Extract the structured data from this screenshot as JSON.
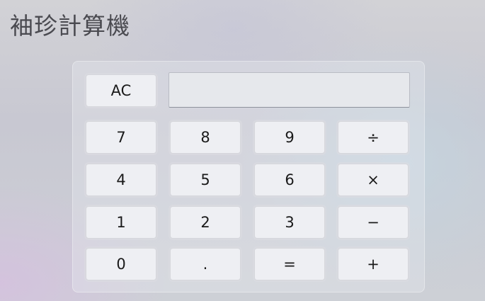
{
  "app": {
    "title": "袖珍計算機"
  },
  "display": {
    "value": ""
  },
  "keys": {
    "clear": "AC",
    "seven": "7",
    "eight": "8",
    "nine": "9",
    "divide": "÷",
    "four": "4",
    "five": "5",
    "six": "6",
    "multiply": "×",
    "one": "1",
    "two": "2",
    "three": "3",
    "subtract": "−",
    "zero": "0",
    "decimal": ".",
    "equals": "=",
    "add": "+"
  }
}
